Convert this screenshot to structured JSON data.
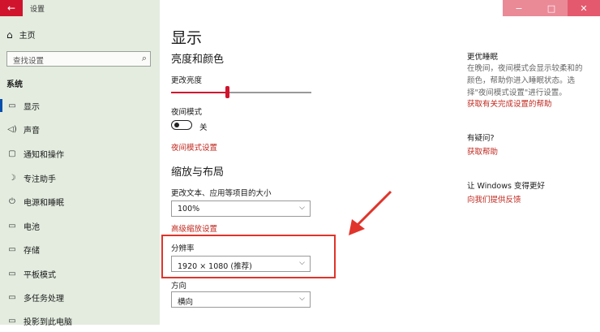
{
  "window": {
    "title": "设置",
    "back": "←",
    "minimize": "−",
    "maximize": "□",
    "close": "✕"
  },
  "sidebar": {
    "home": {
      "icon": "⌂",
      "label": "主页"
    },
    "search_placeholder": "查找设置",
    "search_icon": "⌕",
    "section": "系统",
    "items": [
      {
        "icon": "▭",
        "label": "显示",
        "active": true
      },
      {
        "icon": "◁)",
        "label": "声音"
      },
      {
        "icon": "▢",
        "label": "通知和操作"
      },
      {
        "icon": "☽",
        "label": "专注助手"
      },
      {
        "icon": "⏻",
        "label": "电源和睡眠"
      },
      {
        "icon": "▭",
        "label": "电池"
      },
      {
        "icon": "▭",
        "label": "存储"
      },
      {
        "icon": "▭",
        "label": "平板模式"
      },
      {
        "icon": "▭",
        "label": "多任务处理"
      },
      {
        "icon": "▭",
        "label": "投影到此电脑"
      }
    ]
  },
  "main": {
    "page_title": "显示",
    "brightness": {
      "heading": "亮度和颜色",
      "label": "更改亮度",
      "level": 0.4
    },
    "night": {
      "label": "夜间模式",
      "state": "关",
      "link": "夜间模式设置"
    },
    "scale": {
      "heading": "缩放与布局",
      "text_size_label": "更改文本、应用等项目的大小",
      "text_size_value": "100%",
      "advanced_link": "高级缩放设置",
      "resolution_label": "分辨率",
      "resolution_value": "1920 × 1080 (推荐)",
      "orientation_label": "方向",
      "orientation_value": "横向"
    }
  },
  "right": {
    "sleep": {
      "title": "更优睡眠",
      "desc": "在晚间，夜间模式会显示较柔和的颜色，帮助你进入睡眠状态。选择\"夜间模式设置\"进行设置。",
      "link": "获取有关完成设置的帮助"
    },
    "question": {
      "title": "有疑问?",
      "link": "获取帮助"
    },
    "better": {
      "title": "让 Windows 变得更好",
      "link": "向我们提供反馈"
    }
  },
  "colors": {
    "accent": "#d0142e",
    "link": "#c0291f",
    "sidebar_bg": "#e3ecdf",
    "annotation": "#e0342a"
  }
}
